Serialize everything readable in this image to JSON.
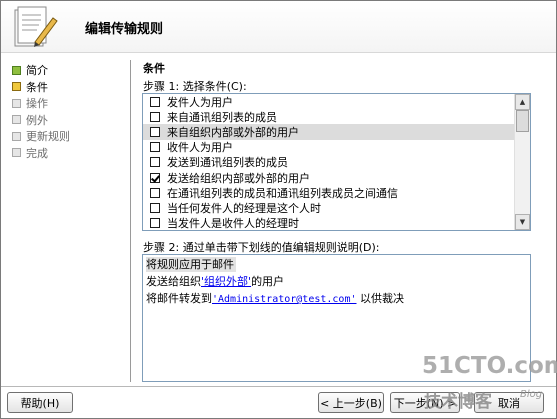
{
  "header": {
    "title": "编辑传输规则"
  },
  "nav": {
    "items": [
      {
        "label": "简介",
        "state": "done"
      },
      {
        "label": "条件",
        "state": "current"
      },
      {
        "label": "操作",
        "state": "todo"
      },
      {
        "label": "例外",
        "state": "todo"
      },
      {
        "label": "更新规则",
        "state": "todo"
      },
      {
        "label": "完成",
        "state": "todo"
      }
    ]
  },
  "main": {
    "section_title": "条件",
    "step1_label": "步骤 1: 选择条件(C):",
    "conditions": [
      {
        "label": "发件人为用户",
        "checked": false,
        "selected": false
      },
      {
        "label": "来自通讯组列表的成员",
        "checked": false,
        "selected": false
      },
      {
        "label": "来自组织内部或外部的用户",
        "checked": false,
        "selected": true
      },
      {
        "label": "收件人为用户",
        "checked": false,
        "selected": false
      },
      {
        "label": "发送到通讯组列表的成员",
        "checked": false,
        "selected": false
      },
      {
        "label": "发送给组织内部或外部的用户",
        "checked": true,
        "selected": false
      },
      {
        "label": "在通讯组列表的成员和通讯组列表成员之间通信",
        "checked": false,
        "selected": false
      },
      {
        "label": "当任何发件人的经理是这个人时",
        "checked": false,
        "selected": false
      },
      {
        "label": "当发件人是收件人的经理时",
        "checked": false,
        "selected": false
      }
    ],
    "step2_label": "步骤 2: 通过单击带下划线的值编辑规则说明(D):",
    "description": {
      "line1": "将规则应用于邮件",
      "line2_prefix": "发送给组织",
      "line2_link": "'组织外部'",
      "line2_suffix": "的用户",
      "line3_prefix": "将邮件转发到",
      "line3_link": "'Administrator@test.com'",
      "line3_suffix": " 以供裁决"
    }
  },
  "buttons": {
    "help": "帮助(H)",
    "back": "< 上一步(B)",
    "next": "下一步(N) >",
    "cancel": "取消"
  },
  "watermark": {
    "site": "51CTO.com",
    "tagline": "技术博客",
    "blog": "Blog"
  },
  "colors": {
    "done": "#8fbf3f",
    "current": "#f0c83c",
    "todo": "#e6e6e6",
    "link": "#0000ee"
  }
}
